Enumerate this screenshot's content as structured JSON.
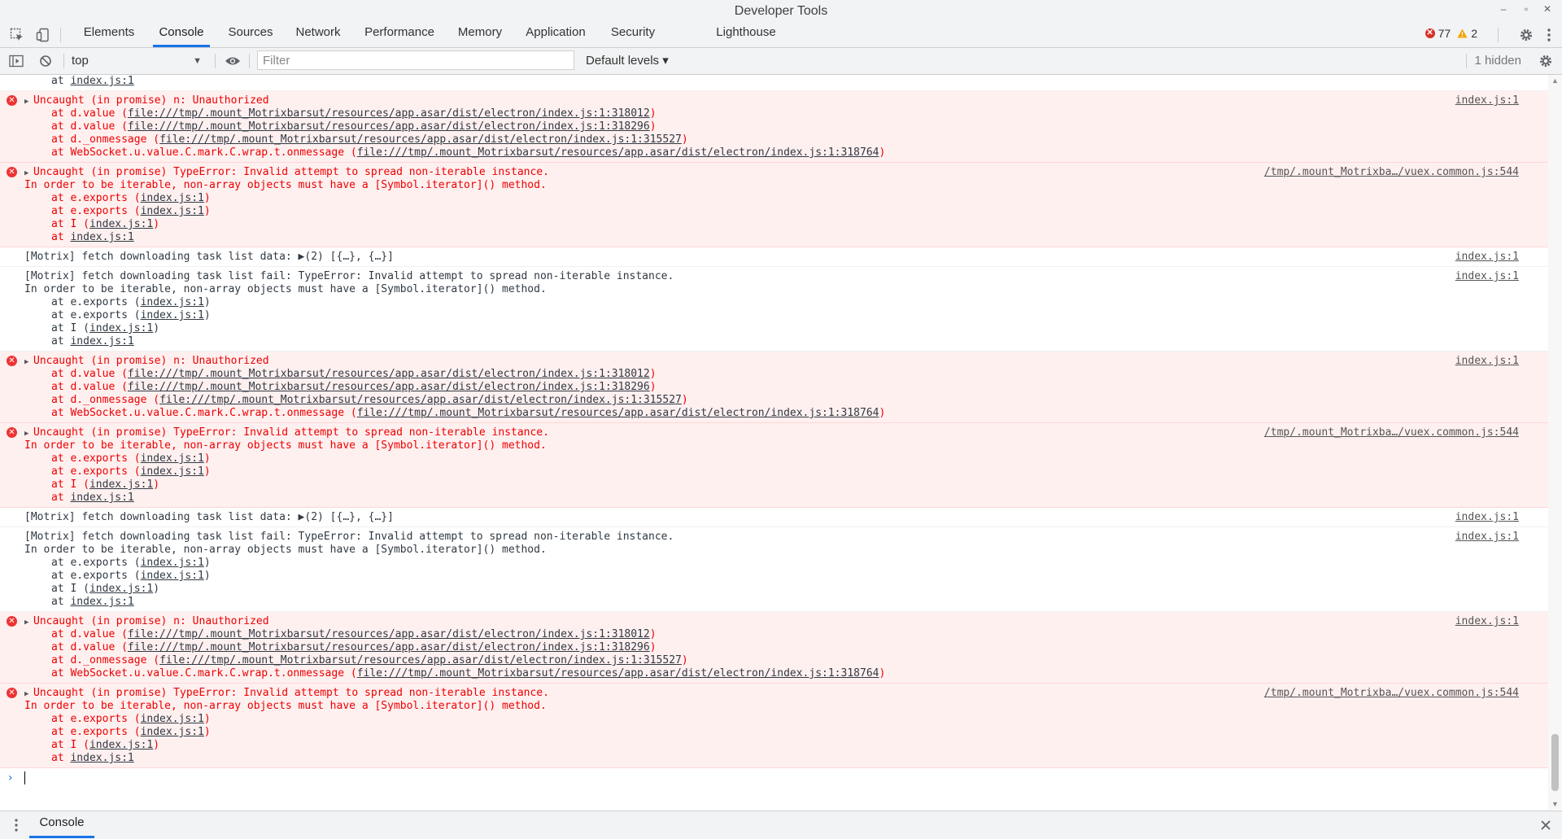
{
  "window": {
    "title": "Developer Tools"
  },
  "tabs": [
    "Elements",
    "Console",
    "Sources",
    "Network",
    "Performance",
    "Memory",
    "Application",
    "Security",
    "Lighthouse"
  ],
  "active_tab": "Console",
  "counts": {
    "errors": "77",
    "warnings": "2"
  },
  "toolbar": {
    "context": "top",
    "filter_placeholder": "Filter",
    "levels": "Default levels ▾",
    "hidden": "1 hidden"
  },
  "colors": {
    "accent": "#1a73e8",
    "error_text": "#ee0000",
    "error_bg": "#fff0f0"
  },
  "top_partial": "at index.js:1",
  "messages": [
    {
      "type": "error",
      "first": "Uncaught (in promise) n: Unauthorized",
      "source": "index.js:1",
      "lines": [
        {
          "pre": "at d.value (",
          "link": "file:///tmp/.mount_Motrixbarsut/resources/app.asar/dist/electron/index.js:1:318012",
          "post": ")"
        },
        {
          "pre": "at d.value (",
          "link": "file:///tmp/.mount_Motrixbarsut/resources/app.asar/dist/electron/index.js:1:318296",
          "post": ")"
        },
        {
          "pre": "at d._onmessage (",
          "link": "file:///tmp/.mount_Motrixbarsut/resources/app.asar/dist/electron/index.js:1:315527",
          "post": ")"
        },
        {
          "pre": "at WebSocket.u.value.C.mark.C.wrap.t.onmessage (",
          "link": "file:///tmp/.mount_Motrixbarsut/resources/app.asar/dist/electron/index.js:1:318764",
          "post": ")"
        }
      ]
    },
    {
      "type": "error",
      "first": "Uncaught (in promise) TypeError: Invalid attempt to spread non-iterable instance.",
      "second": "In order to be iterable, non-array objects must have a [Symbol.iterator]() method.",
      "source": "/tmp/.mount_Motrixba…/vuex.common.js:544",
      "lines": [
        {
          "pre": "at e.exports (",
          "link": "index.js:1",
          "post": ")"
        },
        {
          "pre": "at e.exports (",
          "link": "index.js:1",
          "post": ")"
        },
        {
          "pre": "at I (",
          "link": "index.js:1",
          "post": ")"
        },
        {
          "pre": "at ",
          "link": "index.js:1",
          "post": ""
        }
      ]
    },
    {
      "type": "log",
      "first": "[Motrix] fetch downloading task list data: ▶(2) [{…}, {…}]",
      "source": "index.js:1",
      "lines": []
    },
    {
      "type": "log",
      "first": "[Motrix] fetch downloading task list fail: TypeError: Invalid attempt to spread non-iterable instance.",
      "second": "In order to be iterable, non-array objects must have a [Symbol.iterator]() method.",
      "source": "index.js:1",
      "lines": [
        {
          "pre": "at e.exports (",
          "link": "index.js:1",
          "post": ")"
        },
        {
          "pre": "at e.exports (",
          "link": "index.js:1",
          "post": ")"
        },
        {
          "pre": "at I (",
          "link": "index.js:1",
          "post": ")"
        },
        {
          "pre": "at ",
          "link": "index.js:1",
          "post": ""
        }
      ]
    },
    {
      "type": "error",
      "first": "Uncaught (in promise) n: Unauthorized",
      "source": "index.js:1",
      "lines": [
        {
          "pre": "at d.value (",
          "link": "file:///tmp/.mount_Motrixbarsut/resources/app.asar/dist/electron/index.js:1:318012",
          "post": ")"
        },
        {
          "pre": "at d.value (",
          "link": "file:///tmp/.mount_Motrixbarsut/resources/app.asar/dist/electron/index.js:1:318296",
          "post": ")"
        },
        {
          "pre": "at d._onmessage (",
          "link": "file:///tmp/.mount_Motrixbarsut/resources/app.asar/dist/electron/index.js:1:315527",
          "post": ")"
        },
        {
          "pre": "at WebSocket.u.value.C.mark.C.wrap.t.onmessage (",
          "link": "file:///tmp/.mount_Motrixbarsut/resources/app.asar/dist/electron/index.js:1:318764",
          "post": ")"
        }
      ]
    },
    {
      "type": "error",
      "first": "Uncaught (in promise) TypeError: Invalid attempt to spread non-iterable instance.",
      "second": "In order to be iterable, non-array objects must have a [Symbol.iterator]() method.",
      "source": "/tmp/.mount_Motrixba…/vuex.common.js:544",
      "lines": [
        {
          "pre": "at e.exports (",
          "link": "index.js:1",
          "post": ")"
        },
        {
          "pre": "at e.exports (",
          "link": "index.js:1",
          "post": ")"
        },
        {
          "pre": "at I (",
          "link": "index.js:1",
          "post": ")"
        },
        {
          "pre": "at ",
          "link": "index.js:1",
          "post": ""
        }
      ]
    },
    {
      "type": "log",
      "first": "[Motrix] fetch downloading task list data: ▶(2) [{…}, {…}]",
      "source": "index.js:1",
      "lines": []
    },
    {
      "type": "log",
      "first": "[Motrix] fetch downloading task list fail: TypeError: Invalid attempt to spread non-iterable instance.",
      "second": "In order to be iterable, non-array objects must have a [Symbol.iterator]() method.",
      "source": "index.js:1",
      "lines": [
        {
          "pre": "at e.exports (",
          "link": "index.js:1",
          "post": ")"
        },
        {
          "pre": "at e.exports (",
          "link": "index.js:1",
          "post": ")"
        },
        {
          "pre": "at I (",
          "link": "index.js:1",
          "post": ")"
        },
        {
          "pre": "at ",
          "link": "index.js:1",
          "post": ""
        }
      ]
    },
    {
      "type": "error",
      "first": "Uncaught (in promise) n: Unauthorized",
      "source": "index.js:1",
      "lines": [
        {
          "pre": "at d.value (",
          "link": "file:///tmp/.mount_Motrixbarsut/resources/app.asar/dist/electron/index.js:1:318012",
          "post": ")"
        },
        {
          "pre": "at d.value (",
          "link": "file:///tmp/.mount_Motrixbarsut/resources/app.asar/dist/electron/index.js:1:318296",
          "post": ")"
        },
        {
          "pre": "at d._onmessage (",
          "link": "file:///tmp/.mount_Motrixbarsut/resources/app.asar/dist/electron/index.js:1:315527",
          "post": ")"
        },
        {
          "pre": "at WebSocket.u.value.C.mark.C.wrap.t.onmessage (",
          "link": "file:///tmp/.mount_Motrixbarsut/resources/app.asar/dist/electron/index.js:1:318764",
          "post": ")"
        }
      ]
    },
    {
      "type": "error",
      "first": "Uncaught (in promise) TypeError: Invalid attempt to spread non-iterable instance.",
      "second": "In order to be iterable, non-array objects must have a [Symbol.iterator]() method.",
      "source": "/tmp/.mount_Motrixba…/vuex.common.js:544",
      "lines": [
        {
          "pre": "at e.exports (",
          "link": "index.js:1",
          "post": ")"
        },
        {
          "pre": "at e.exports (",
          "link": "index.js:1",
          "post": ")"
        },
        {
          "pre": "at I (",
          "link": "index.js:1",
          "post": ")"
        },
        {
          "pre": "at ",
          "link": "index.js:1",
          "post": ""
        }
      ]
    }
  ],
  "drawer": {
    "tab": "Console"
  }
}
